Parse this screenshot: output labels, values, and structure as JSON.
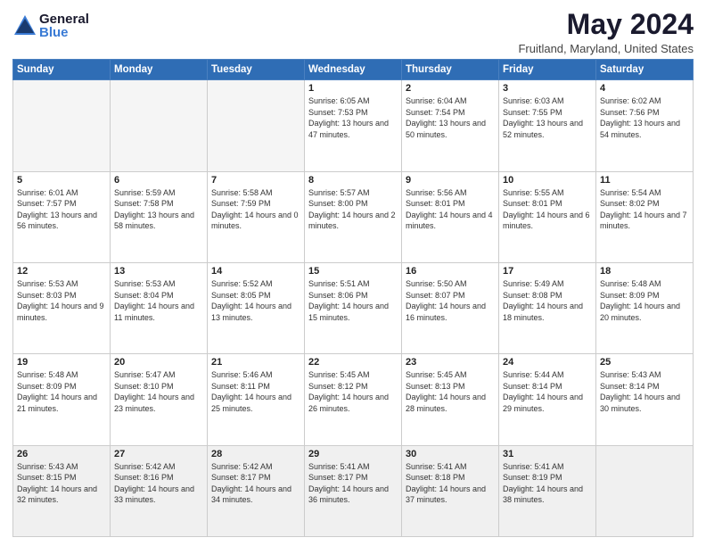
{
  "logo": {
    "general": "General",
    "blue": "Blue"
  },
  "header": {
    "title": "May 2024",
    "subtitle": "Fruitland, Maryland, United States"
  },
  "weekdays": [
    "Sunday",
    "Monday",
    "Tuesday",
    "Wednesday",
    "Thursday",
    "Friday",
    "Saturday"
  ],
  "weeks": [
    [
      {
        "day": "",
        "info": ""
      },
      {
        "day": "",
        "info": ""
      },
      {
        "day": "",
        "info": ""
      },
      {
        "day": "1",
        "info": "Sunrise: 6:05 AM\nSunset: 7:53 PM\nDaylight: 13 hours\nand 47 minutes."
      },
      {
        "day": "2",
        "info": "Sunrise: 6:04 AM\nSunset: 7:54 PM\nDaylight: 13 hours\nand 50 minutes."
      },
      {
        "day": "3",
        "info": "Sunrise: 6:03 AM\nSunset: 7:55 PM\nDaylight: 13 hours\nand 52 minutes."
      },
      {
        "day": "4",
        "info": "Sunrise: 6:02 AM\nSunset: 7:56 PM\nDaylight: 13 hours\nand 54 minutes."
      }
    ],
    [
      {
        "day": "5",
        "info": "Sunrise: 6:01 AM\nSunset: 7:57 PM\nDaylight: 13 hours\nand 56 minutes."
      },
      {
        "day": "6",
        "info": "Sunrise: 5:59 AM\nSunset: 7:58 PM\nDaylight: 13 hours\nand 58 minutes."
      },
      {
        "day": "7",
        "info": "Sunrise: 5:58 AM\nSunset: 7:59 PM\nDaylight: 14 hours\nand 0 minutes."
      },
      {
        "day": "8",
        "info": "Sunrise: 5:57 AM\nSunset: 8:00 PM\nDaylight: 14 hours\nand 2 minutes."
      },
      {
        "day": "9",
        "info": "Sunrise: 5:56 AM\nSunset: 8:01 PM\nDaylight: 14 hours\nand 4 minutes."
      },
      {
        "day": "10",
        "info": "Sunrise: 5:55 AM\nSunset: 8:01 PM\nDaylight: 14 hours\nand 6 minutes."
      },
      {
        "day": "11",
        "info": "Sunrise: 5:54 AM\nSunset: 8:02 PM\nDaylight: 14 hours\nand 7 minutes."
      }
    ],
    [
      {
        "day": "12",
        "info": "Sunrise: 5:53 AM\nSunset: 8:03 PM\nDaylight: 14 hours\nand 9 minutes."
      },
      {
        "day": "13",
        "info": "Sunrise: 5:53 AM\nSunset: 8:04 PM\nDaylight: 14 hours\nand 11 minutes."
      },
      {
        "day": "14",
        "info": "Sunrise: 5:52 AM\nSunset: 8:05 PM\nDaylight: 14 hours\nand 13 minutes."
      },
      {
        "day": "15",
        "info": "Sunrise: 5:51 AM\nSunset: 8:06 PM\nDaylight: 14 hours\nand 15 minutes."
      },
      {
        "day": "16",
        "info": "Sunrise: 5:50 AM\nSunset: 8:07 PM\nDaylight: 14 hours\nand 16 minutes."
      },
      {
        "day": "17",
        "info": "Sunrise: 5:49 AM\nSunset: 8:08 PM\nDaylight: 14 hours\nand 18 minutes."
      },
      {
        "day": "18",
        "info": "Sunrise: 5:48 AM\nSunset: 8:09 PM\nDaylight: 14 hours\nand 20 minutes."
      }
    ],
    [
      {
        "day": "19",
        "info": "Sunrise: 5:48 AM\nSunset: 8:09 PM\nDaylight: 14 hours\nand 21 minutes."
      },
      {
        "day": "20",
        "info": "Sunrise: 5:47 AM\nSunset: 8:10 PM\nDaylight: 14 hours\nand 23 minutes."
      },
      {
        "day": "21",
        "info": "Sunrise: 5:46 AM\nSunset: 8:11 PM\nDaylight: 14 hours\nand 25 minutes."
      },
      {
        "day": "22",
        "info": "Sunrise: 5:45 AM\nSunset: 8:12 PM\nDaylight: 14 hours\nand 26 minutes."
      },
      {
        "day": "23",
        "info": "Sunrise: 5:45 AM\nSunset: 8:13 PM\nDaylight: 14 hours\nand 28 minutes."
      },
      {
        "day": "24",
        "info": "Sunrise: 5:44 AM\nSunset: 8:14 PM\nDaylight: 14 hours\nand 29 minutes."
      },
      {
        "day": "25",
        "info": "Sunrise: 5:43 AM\nSunset: 8:14 PM\nDaylight: 14 hours\nand 30 minutes."
      }
    ],
    [
      {
        "day": "26",
        "info": "Sunrise: 5:43 AM\nSunset: 8:15 PM\nDaylight: 14 hours\nand 32 minutes."
      },
      {
        "day": "27",
        "info": "Sunrise: 5:42 AM\nSunset: 8:16 PM\nDaylight: 14 hours\nand 33 minutes."
      },
      {
        "day": "28",
        "info": "Sunrise: 5:42 AM\nSunset: 8:17 PM\nDaylight: 14 hours\nand 34 minutes."
      },
      {
        "day": "29",
        "info": "Sunrise: 5:41 AM\nSunset: 8:17 PM\nDaylight: 14 hours\nand 36 minutes."
      },
      {
        "day": "30",
        "info": "Sunrise: 5:41 AM\nSunset: 8:18 PM\nDaylight: 14 hours\nand 37 minutes."
      },
      {
        "day": "31",
        "info": "Sunrise: 5:41 AM\nSunset: 8:19 PM\nDaylight: 14 hours\nand 38 minutes."
      },
      {
        "day": "",
        "info": ""
      }
    ]
  ]
}
